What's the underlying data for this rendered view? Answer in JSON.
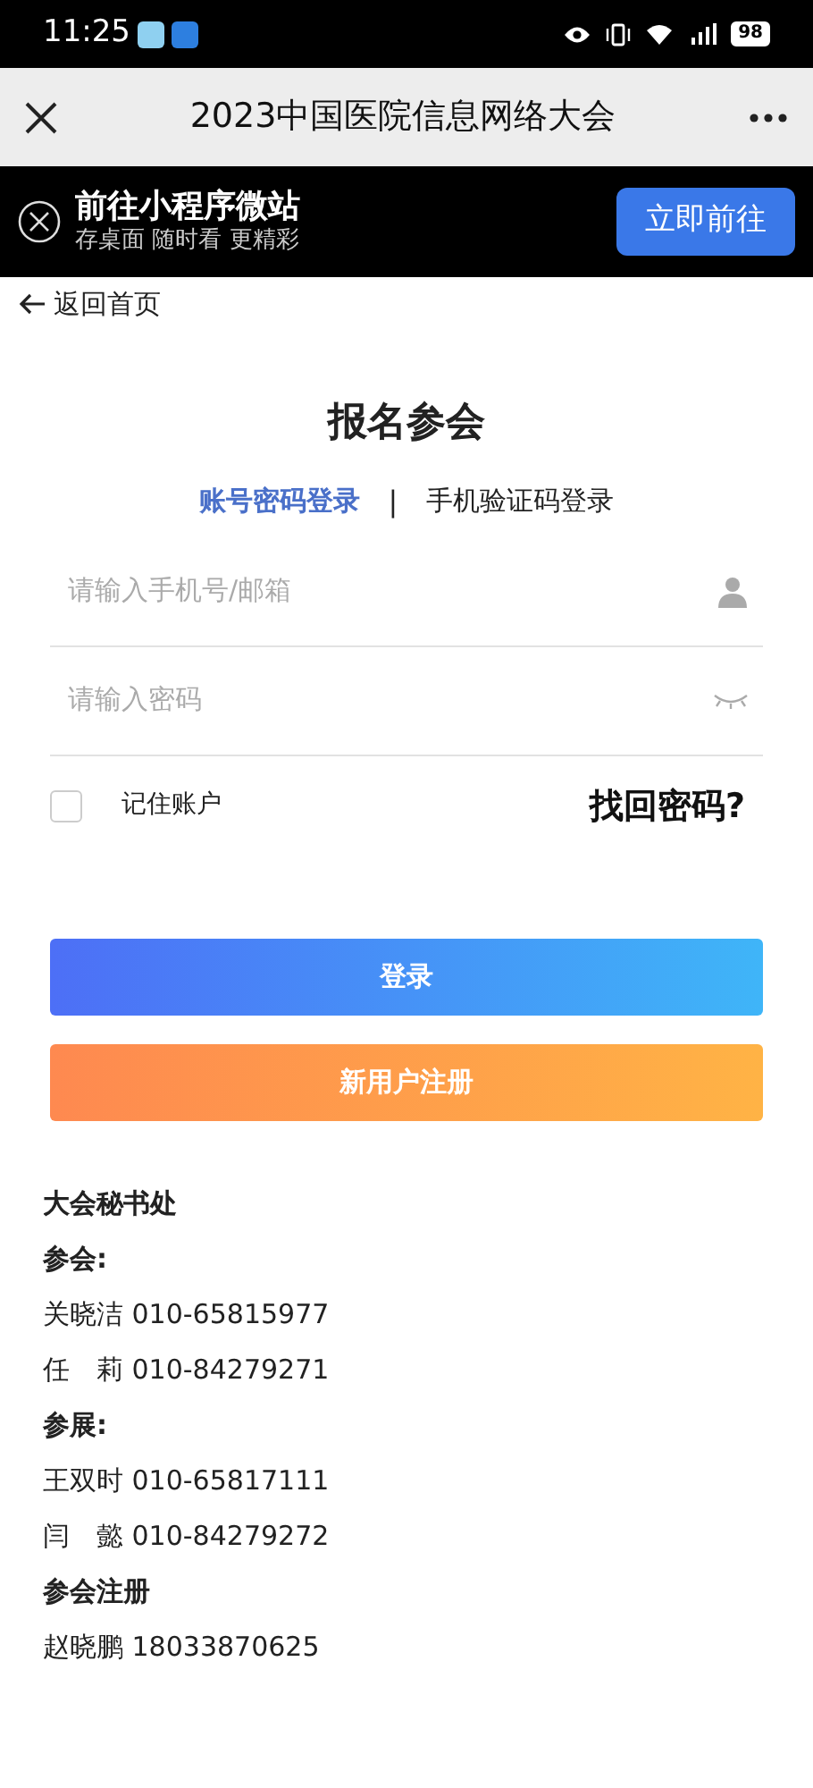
{
  "status_bar": {
    "time": "11:25",
    "battery": "98"
  },
  "nav_bar": {
    "title": "2023中国医院信息网络大会"
  },
  "banner": {
    "title": "前往小程序微站",
    "subtitle": "存桌面 随时看 更精彩",
    "button": "立即前往"
  },
  "back_link": "返回首页",
  "page_title": "报名参会",
  "tab_separator": "|",
  "login_tabs": [
    {
      "label": "账号密码登录",
      "selected": true
    },
    {
      "label": "手机验证码登录",
      "selected": false
    }
  ],
  "fields": [
    {
      "kind": "account",
      "placeholder": "请输入手机号/邮箱"
    },
    {
      "kind": "password",
      "placeholder": "请输入密码"
    }
  ],
  "remember": {
    "label": "记住账户",
    "checked": false
  },
  "forgot_link": "找回密码?",
  "buttons": [
    {
      "kind": "login",
      "label": "登录"
    },
    {
      "kind": "register",
      "label": "新用户注册"
    }
  ],
  "contacts": [
    {
      "kind": "heading",
      "text": "大会秘书处"
    },
    {
      "kind": "heading",
      "text": "参会:"
    },
    {
      "kind": "line",
      "text": "关晓洁 010-65815977"
    },
    {
      "kind": "line",
      "text": "任　莉 010-84279271"
    },
    {
      "kind": "heading",
      "text": "参展:"
    },
    {
      "kind": "line",
      "text": "王双时 010-65817111"
    },
    {
      "kind": "line",
      "text": "闫　懿 010-84279272"
    },
    {
      "kind": "heading",
      "text": "参会注册"
    },
    {
      "kind": "line",
      "text": "赵晓鹏 18033870625"
    }
  ]
}
